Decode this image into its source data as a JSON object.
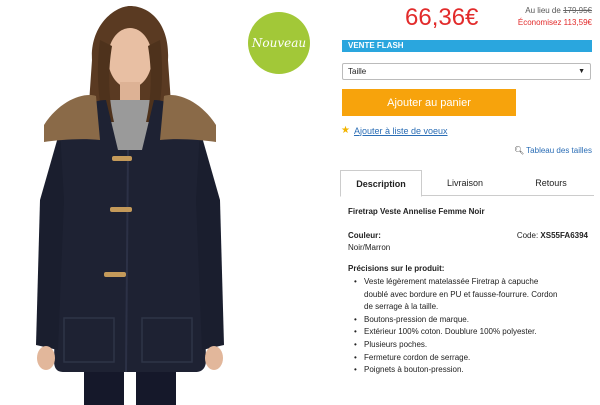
{
  "badge": {
    "label": "Nouveau"
  },
  "pricing": {
    "price": "66,36€",
    "was_prefix": "Au lieu de",
    "was_price": "179,95€",
    "savings": "Économisez 113,59€"
  },
  "flash": {
    "label": "VENTE FLASH"
  },
  "size_select": {
    "selected": "Taille"
  },
  "cart": {
    "button_label": "Ajouter au panier"
  },
  "wishlist": {
    "label": "Ajouter à liste de voeux"
  },
  "size_chart": {
    "label": "Tableau des tailles"
  },
  "tabs": [
    {
      "label": "Description",
      "active": true
    },
    {
      "label": "Livraison",
      "active": false
    },
    {
      "label": "Retours",
      "active": false
    }
  ],
  "product": {
    "title": "Firetrap Veste Annelise Femme Noir",
    "color_label": "Couleur:",
    "color_value": "Noir/Marron",
    "code_label": "Code:",
    "code_value": "XS55FA6394",
    "details_label": "Précisions sur le produit:",
    "features": [
      "Veste légèrement matelassée Firetrap à capuche",
      "doublé avec bordure en PU et fausse-fourrure. Cordon",
      "de serrage à la taille.",
      "Boutons-pression de marque.",
      "Extérieur 100% coton. Doublure 100% polyester.",
      "Plusieurs poches.",
      "Fermeture cordon de serrage.",
      "Poignets à bouton-pression."
    ]
  },
  "colors": {
    "price_red": "#e22b2b",
    "flash_blue": "#2aa6de",
    "cart_orange": "#f7a30c",
    "link_blue": "#2a6db5",
    "badge_green": "#a2c838"
  },
  "icons": {
    "badge": "circle-badge",
    "wishlist": "star-icon",
    "size_chart": "magnifier-icon",
    "select": "caret-down-icon"
  }
}
